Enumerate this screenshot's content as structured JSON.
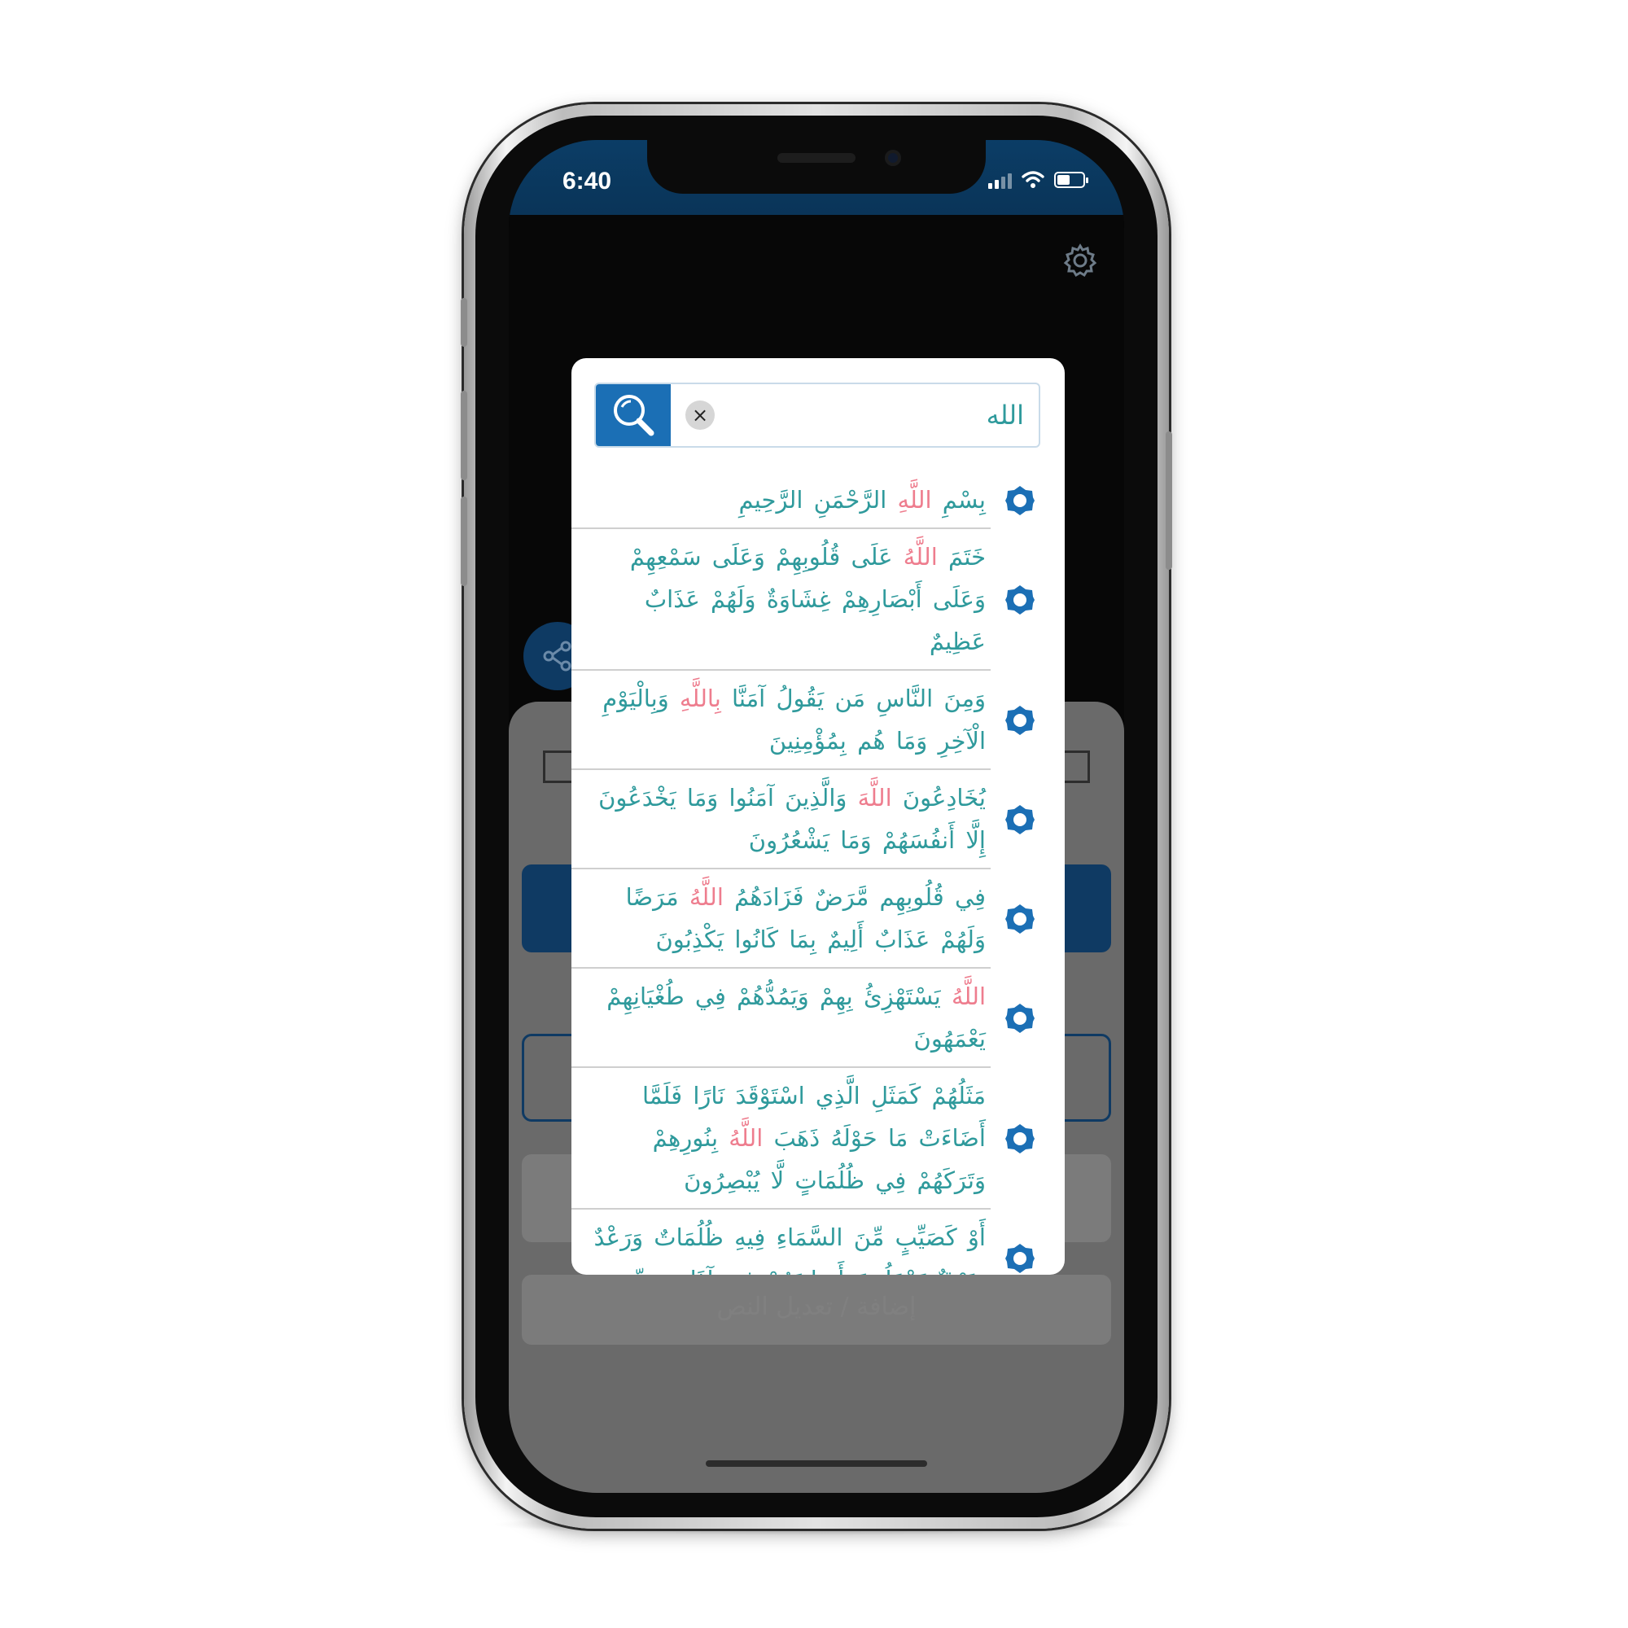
{
  "status_bar": {
    "time": "6:40"
  },
  "search": {
    "query": "الله",
    "clear_label": "×"
  },
  "highlight_term": "الله",
  "results": [
    {
      "before": "بِسْمِ ",
      "highlight": "اللَّهِ",
      "after": " الرَّحْمَنِ الرَّحِيمِ"
    },
    {
      "before": "خَتَمَ ",
      "highlight": "اللَّهُ",
      "after": " عَلَى قُلُوبِهِمْ وَعَلَى سَمْعِهِمْ وَعَلَى أَبْصَارِهِمْ غِشَاوَةٌ وَلَهُمْ عَذَابٌ عَظِيمٌ"
    },
    {
      "before": "وَمِنَ النَّاسِ مَن يَقُولُ آمَنَّا ",
      "highlight": "بِاللَّهِ",
      "after": " وَبِالْيَوْمِ الْآخِرِ وَمَا هُم بِمُؤْمِنِينَ"
    },
    {
      "before": "يُخَادِعُونَ ",
      "highlight": "اللَّهَ",
      "after": " وَالَّذِينَ آمَنُوا وَمَا يَخْدَعُونَ إِلَّا أَنفُسَهُمْ وَمَا يَشْعُرُونَ"
    },
    {
      "before": "فِي قُلُوبِهِم مَّرَضٌ فَزَادَهُمُ ",
      "highlight": "اللَّهُ",
      "after": " مَرَضًا وَلَهُمْ عَذَابٌ أَلِيمٌ بِمَا كَانُوا يَكْذِبُونَ"
    },
    {
      "before": "",
      "highlight": "اللَّهُ",
      "after": " يَسْتَهْزِئُ بِهِمْ وَيَمُدُّهُمْ فِي طُغْيَانِهِمْ يَعْمَهُونَ"
    },
    {
      "before": "مَثَلُهُمْ كَمَثَلِ الَّذِي اسْتَوْقَدَ نَارًا فَلَمَّا أَضَاءَتْ مَا حَوْلَهُ ذَهَبَ ",
      "highlight": "اللَّهُ",
      "after": " بِنُورِهِمْ وَتَرَكَهُمْ فِي ظُلُمَاتٍ لَّا يُبْصِرُونَ"
    },
    {
      "before": "أَوْ كَصَيِّبٍ مِّنَ السَّمَاءِ فِيهِ ظُلُمَاتٌ وَرَعْدٌ وَبَرْقٌ يَجْعَلُونَ أَصَابِعَهُمْ فِي آذَانِهِم مِّنَ",
      "highlight": "",
      "after": ""
    }
  ],
  "background_sheet": {
    "add_edit_label": "إضافة / تعديل النص"
  },
  "colors": {
    "accent_blue": "#1b6fb5",
    "verse_text": "#2f9a9c",
    "highlight": "#ee7d8e",
    "status_bar": "#0b3d66"
  },
  "icons": {
    "search_button": "magnifier-icon",
    "clear_button": "close-icon",
    "verse_marker": "verse-marker-icon",
    "settings": "gear-icon",
    "share": "share-icon"
  }
}
